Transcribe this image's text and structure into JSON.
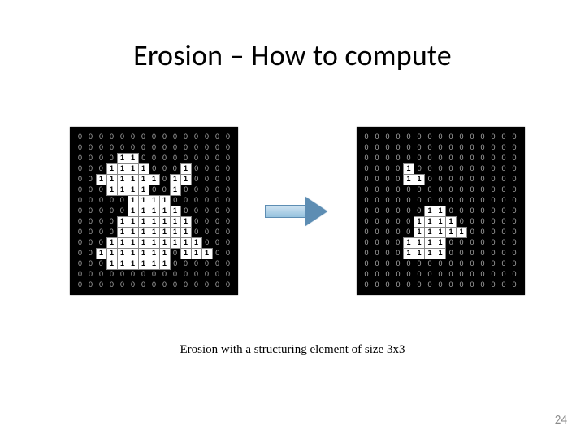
{
  "title": "Erosion – How to compute",
  "caption": "Erosion with a structuring element of size 3x3",
  "page_number": "24",
  "grid_rows": 15,
  "grid_cols": 15,
  "matrix_left": [
    [
      0,
      0,
      0,
      0,
      0,
      0,
      0,
      0,
      0,
      0,
      0,
      0,
      0,
      0,
      0
    ],
    [
      0,
      0,
      0,
      0,
      0,
      0,
      0,
      0,
      0,
      0,
      0,
      0,
      0,
      0,
      0
    ],
    [
      0,
      0,
      0,
      0,
      1,
      1,
      0,
      0,
      0,
      0,
      0,
      0,
      0,
      0,
      0
    ],
    [
      0,
      0,
      0,
      1,
      1,
      1,
      1,
      0,
      0,
      0,
      1,
      0,
      0,
      0,
      0
    ],
    [
      0,
      0,
      1,
      1,
      1,
      1,
      1,
      1,
      0,
      1,
      1,
      0,
      0,
      0,
      0
    ],
    [
      0,
      0,
      0,
      1,
      1,
      1,
      1,
      0,
      0,
      1,
      0,
      0,
      0,
      0,
      0
    ],
    [
      0,
      0,
      0,
      0,
      0,
      1,
      1,
      1,
      1,
      0,
      0,
      0,
      0,
      0,
      0
    ],
    [
      0,
      0,
      0,
      0,
      0,
      1,
      1,
      1,
      1,
      1,
      0,
      0,
      0,
      0,
      0
    ],
    [
      0,
      0,
      0,
      0,
      1,
      1,
      1,
      1,
      1,
      1,
      1,
      0,
      0,
      0,
      0
    ],
    [
      0,
      0,
      0,
      0,
      1,
      1,
      1,
      1,
      1,
      1,
      1,
      0,
      0,
      0,
      0
    ],
    [
      0,
      0,
      0,
      1,
      1,
      1,
      1,
      1,
      1,
      1,
      1,
      1,
      0,
      0,
      0
    ],
    [
      0,
      0,
      1,
      1,
      1,
      1,
      1,
      1,
      1,
      0,
      1,
      1,
      1,
      0,
      0
    ],
    [
      0,
      0,
      0,
      1,
      1,
      1,
      1,
      1,
      1,
      0,
      0,
      0,
      0,
      0,
      0
    ],
    [
      0,
      0,
      0,
      0,
      0,
      0,
      0,
      0,
      0,
      0,
      0,
      0,
      0,
      0,
      0
    ],
    [
      0,
      0,
      0,
      0,
      0,
      0,
      0,
      0,
      0,
      0,
      0,
      0,
      0,
      0,
      0
    ]
  ],
  "matrix_right": [
    [
      0,
      0,
      0,
      0,
      0,
      0,
      0,
      0,
      0,
      0,
      0,
      0,
      0,
      0,
      0
    ],
    [
      0,
      0,
      0,
      0,
      0,
      0,
      0,
      0,
      0,
      0,
      0,
      0,
      0,
      0,
      0
    ],
    [
      0,
      0,
      0,
      0,
      0,
      0,
      0,
      0,
      0,
      0,
      0,
      0,
      0,
      0,
      0
    ],
    [
      0,
      0,
      0,
      0,
      1,
      0,
      0,
      0,
      0,
      0,
      0,
      0,
      0,
      0,
      0
    ],
    [
      0,
      0,
      0,
      0,
      1,
      1,
      0,
      0,
      0,
      0,
      0,
      0,
      0,
      0,
      0
    ],
    [
      0,
      0,
      0,
      0,
      0,
      0,
      0,
      0,
      0,
      0,
      0,
      0,
      0,
      0,
      0
    ],
    [
      0,
      0,
      0,
      0,
      0,
      0,
      0,
      0,
      0,
      0,
      0,
      0,
      0,
      0,
      0
    ],
    [
      0,
      0,
      0,
      0,
      0,
      0,
      1,
      1,
      0,
      0,
      0,
      0,
      0,
      0,
      0
    ],
    [
      0,
      0,
      0,
      0,
      0,
      1,
      1,
      1,
      1,
      0,
      0,
      0,
      0,
      0,
      0
    ],
    [
      0,
      0,
      0,
      0,
      0,
      1,
      1,
      1,
      1,
      1,
      0,
      0,
      0,
      0,
      0
    ],
    [
      0,
      0,
      0,
      0,
      1,
      1,
      1,
      1,
      0,
      0,
      0,
      0,
      0,
      0,
      0
    ],
    [
      0,
      0,
      0,
      0,
      1,
      1,
      1,
      1,
      0,
      0,
      0,
      0,
      0,
      0,
      0
    ],
    [
      0,
      0,
      0,
      0,
      0,
      0,
      0,
      0,
      0,
      0,
      0,
      0,
      0,
      0,
      0
    ],
    [
      0,
      0,
      0,
      0,
      0,
      0,
      0,
      0,
      0,
      0,
      0,
      0,
      0,
      0,
      0
    ],
    [
      0,
      0,
      0,
      0,
      0,
      0,
      0,
      0,
      0,
      0,
      0,
      0,
      0,
      0,
      0
    ]
  ]
}
